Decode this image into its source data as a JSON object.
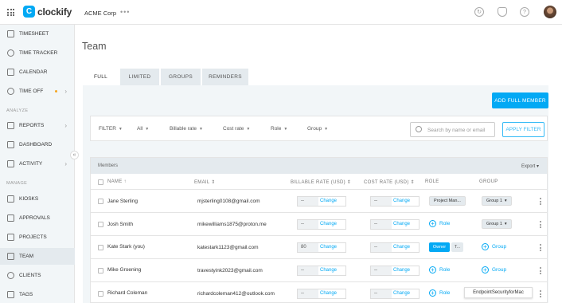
{
  "app": {
    "name": "clockify",
    "logo_letter": "C",
    "workspace": "ACME Corp",
    "ws_menu": "•••"
  },
  "sidebar": {
    "items": [
      {
        "label": "TIMESHEET",
        "icon": "timesheet-icon"
      },
      {
        "label": "TIME TRACKER",
        "icon": "clock-icon"
      },
      {
        "label": "CALENDAR",
        "icon": "calendar-icon"
      },
      {
        "label": "TIME OFF",
        "icon": "time-off-icon"
      },
      {
        "label": "REPORTS",
        "icon": "reports-icon"
      },
      {
        "label": "DASHBOARD",
        "icon": "dashboard-icon"
      },
      {
        "label": "ACTIVITY",
        "icon": "activity-icon"
      },
      {
        "label": "KIOSKS",
        "icon": "kiosk-icon"
      },
      {
        "label": "APPROVALS",
        "icon": "approvals-icon"
      },
      {
        "label": "PROJECTS",
        "icon": "projects-icon"
      },
      {
        "label": "TEAM",
        "icon": "team-icon"
      },
      {
        "label": "CLIENTS",
        "icon": "clients-icon"
      },
      {
        "label": "TAGS",
        "icon": "tags-icon"
      }
    ],
    "sections": {
      "analyze": "ANALYZE",
      "manage": "MANAGE"
    }
  },
  "page": {
    "title": "Team"
  },
  "tabs": [
    "FULL",
    "LIMITED",
    "GROUPS",
    "REMINDERS"
  ],
  "actions": {
    "add_full_member": "ADD FULL MEMBER"
  },
  "filters": {
    "filter": "FILTER",
    "status": "All",
    "billable": "Billable rate",
    "cost": "Cost rate",
    "role": "Role",
    "group": "Group",
    "search_placeholder": "Search by name or email",
    "apply": "APPLY FILTER"
  },
  "table": {
    "caption": "Members",
    "export": "Export",
    "headers": {
      "name": "NAME",
      "email": "EMAIL",
      "billable": "BILLABLE RATE (USD)",
      "cost": "COST RATE (USD)",
      "role": "ROLE",
      "group": "GROUP"
    },
    "change_label": "Change",
    "role_add": "Role",
    "group_add": "Group",
    "rows": [
      {
        "name": "Jane Sterling",
        "email": "mjsterling0108@gmail.com",
        "billable": "--",
        "cost": "--",
        "role": "Project Man...",
        "group": "Group 1"
      },
      {
        "name": "Josh Smith",
        "email": "mikewilliams1875@proton.me",
        "billable": "--",
        "cost": "--",
        "role": "",
        "group": "Group 1"
      },
      {
        "name": "Kate Stark (you)",
        "email": "katestark1123@gmail.com",
        "billable": "80",
        "cost": "--",
        "role": "Owner",
        "role2": "T...",
        "group": ""
      },
      {
        "name": "Mike Groening",
        "email": "travestyink2023@gmail.com",
        "billable": "--",
        "cost": "--",
        "role": "",
        "group": ""
      },
      {
        "name": "Richard Coleman",
        "email": "richardcoleman412@outlook.com",
        "billable": "--",
        "cost": "--",
        "role": "",
        "group": ""
      }
    ]
  },
  "tooltip": "EndpointSecurityforMac",
  "colors": {
    "accent": "#03a9f4",
    "sidebar_bg": "#f2f6f8"
  }
}
